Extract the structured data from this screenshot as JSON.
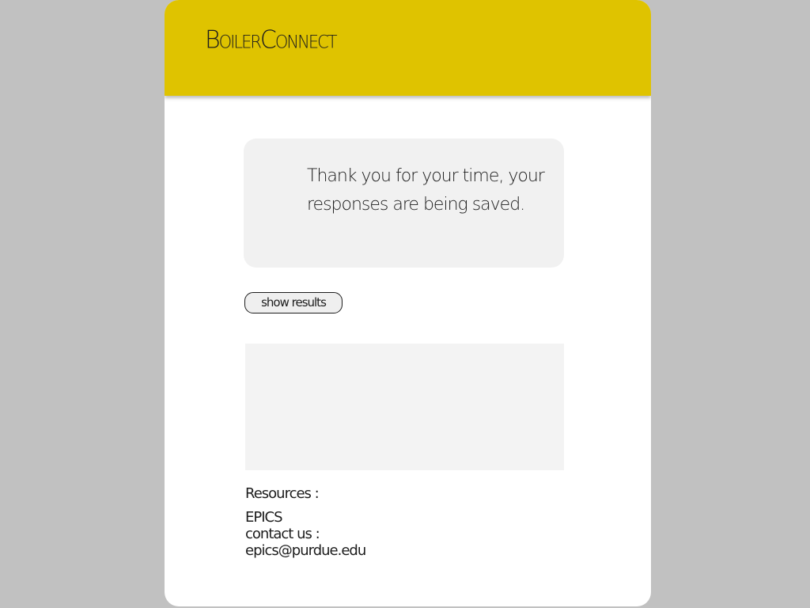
{
  "header": {
    "brand": "BoilerConnect",
    "background_color": "#dfc300"
  },
  "message": {
    "text": "Thank you for your time, your responses are being saved."
  },
  "actions": {
    "show_results_label": "show results"
  },
  "resources": {
    "heading": "Resources :",
    "epics_label": "EPICS",
    "contact_label": "contact us :",
    "email": "epics@purdue.edu"
  },
  "colors": {
    "page_background": "#c1c1c1",
    "card_background": "#ffffff",
    "message_box_background": "#f1f1f1",
    "results_panel_background": "#f3f3f3",
    "text": "#1c1c1c"
  }
}
